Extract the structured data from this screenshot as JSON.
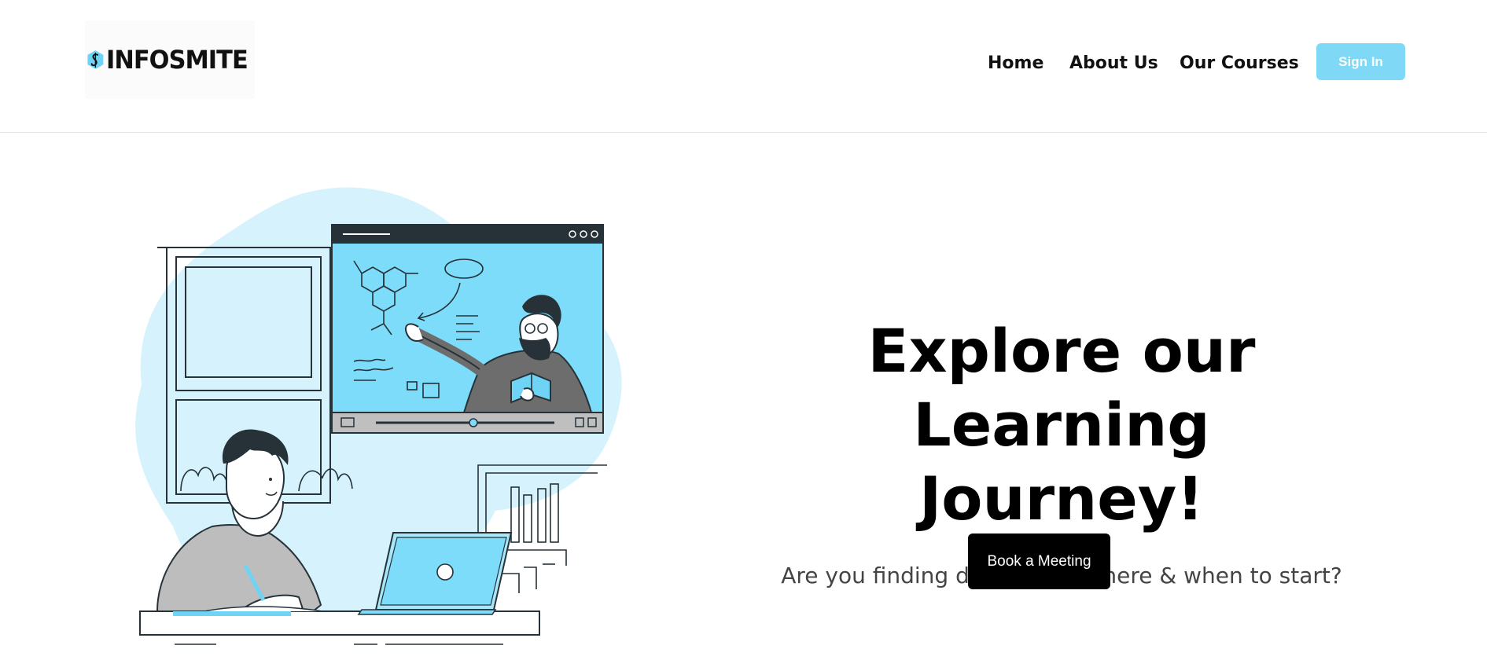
{
  "brand": {
    "name": "INFOSMITE",
    "logo_icon": "hexagon-s-logo-icon",
    "accent_color": "#7ed8f6"
  },
  "nav": {
    "items": [
      {
        "label": "Home"
      },
      {
        "label": "About Us"
      },
      {
        "label": "Our Courses"
      }
    ],
    "signin_label": "Sign In"
  },
  "hero": {
    "title_line1": "Explore our Learning",
    "title_line2": "Journey!",
    "subtitle": "Are you finding difficulty in where & when to start?",
    "cta_label": "Book a Meeting"
  },
  "illustration": {
    "name": "online-learning-illustration",
    "fill_color": "#d6f3fd",
    "screen_color": "#7ddcfa"
  }
}
